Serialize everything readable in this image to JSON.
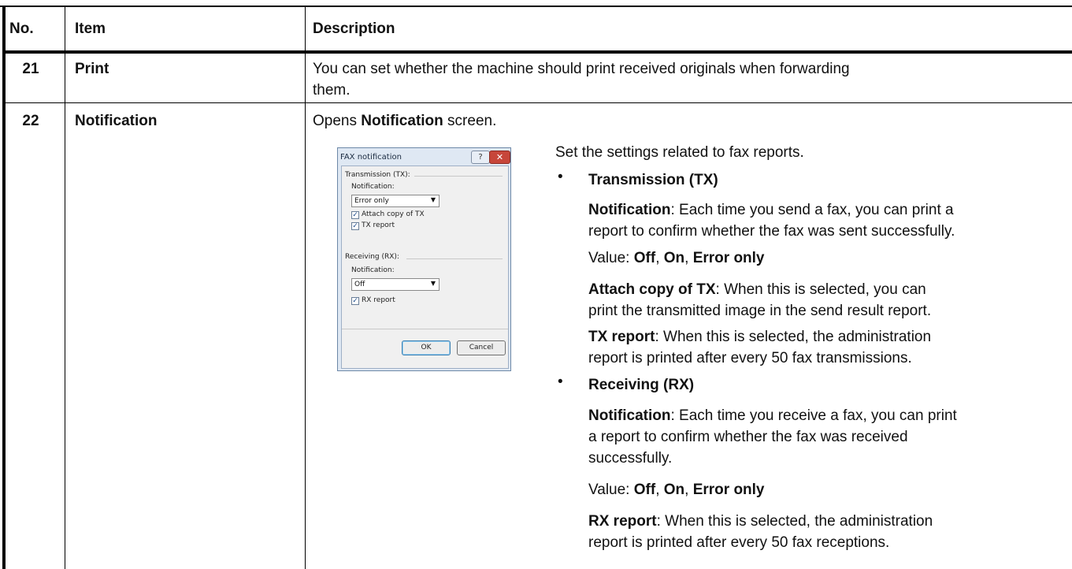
{
  "table": {
    "headers": [
      "No.",
      "Item",
      "Description"
    ],
    "rows": [
      {
        "no": "21",
        "item": "Print",
        "description_lines": [
          "You can set whether the machine should print received originals when forwarding",
          "them."
        ]
      },
      {
        "no": "22",
        "item": "Notification",
        "intro_prefix": "Opens ",
        "intro_bold": "Notification",
        "intro_suffix": " screen."
      }
    ]
  },
  "details": {
    "summary": "Set the settings related to fax reports.",
    "bullet_char": "•",
    "tx_heading": "Transmission (TX)",
    "tx_notification_label": "Notification",
    "tx_notification_lines": [
      ": Each time you send a fax, you can print a",
      "report to confirm whether the fax was sent successfully."
    ],
    "value_prefix": "Value: ",
    "value_off": "Off",
    "value_sep": ", ",
    "value_on": "On",
    "value_error": "Error only",
    "attach_label": "Attach copy of TX",
    "attach_lines": [
      ": When this is selected, you can",
      "print the transmitted image in the send result report."
    ],
    "tx_report_label": "TX report",
    "tx_report_lines": [
      ": When this is selected, the administration",
      "report is printed after every 50 fax transmissions."
    ],
    "rx_heading": "Receiving (RX)",
    "rx_notification_label": "Notification",
    "rx_notification_lines": [
      ": Each time you receive a fax, you can print",
      "a report to confirm whether the fax was received",
      "successfully."
    ],
    "rx_report_label": "RX report",
    "rx_report_lines": [
      ": When this is selected, the administration",
      "report is printed after every 50 fax receptions."
    ]
  },
  "dialog": {
    "title": "FAX notification",
    "help": "?",
    "close": "✕",
    "tx_group": "Transmission (TX):",
    "tx_notification_label": "Notification:",
    "tx_notification_value": "Error only",
    "attach_copy_label": "Attach copy of TX",
    "attach_copy_checked": true,
    "tx_report_label": "TX report",
    "tx_report_checked": true,
    "rx_group": "Receiving (RX):",
    "rx_notification_label": "Notification:",
    "rx_notification_value": "Off",
    "rx_report_label": "RX report",
    "rx_report_checked": true,
    "ok_label": "OK",
    "cancel_label": "Cancel",
    "check_mark": "✓",
    "dropdown_arrow": "▼"
  }
}
